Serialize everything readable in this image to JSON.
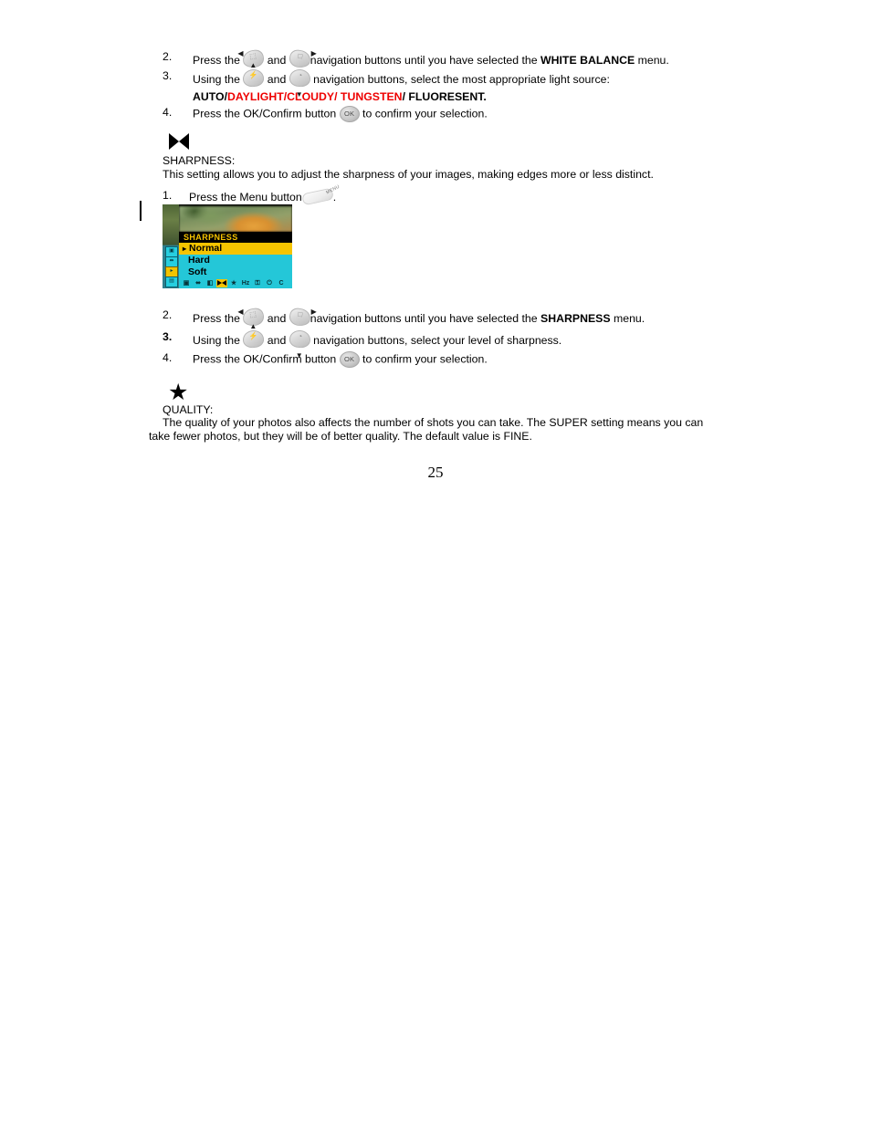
{
  "document": {
    "page_number": "25"
  },
  "white_balance_steps": {
    "step2": {
      "number": "2.",
      "text_before": "Press the",
      "text_mid": "and",
      "text_after": "navigation buttons until you have selected the",
      "emphasis": "WHITE BALANCE",
      "text_end": "menu."
    },
    "step3": {
      "number": "3.",
      "text_before": "Using the",
      "text_mid": "and",
      "text_after": "navigation buttons, select the most appropriate light source:",
      "options_plain_1": "AUTO/",
      "options_red": "DAYLIGHT/CLOUDY/ TUNGSTEN",
      "options_plain_2": "/ FLUORESENT."
    },
    "step4": {
      "number": "4.",
      "text_before": "Press the OK/Confirm button",
      "text_after": "to confirm your selection."
    }
  },
  "sharpness_section": {
    "icon": "bowtie-icon",
    "title": "SHARPNESS:",
    "description": "This setting allows you to adjust the sharpness of your images, making edges more or less distinct.",
    "step1": {
      "number": "1.",
      "text_before": "Press the Menu button",
      "text_after": "."
    },
    "step2": {
      "number": "2.",
      "text_before": "Press the",
      "text_mid": "and",
      "text_after": "navigation buttons until you have selected the",
      "emphasis": "SHARPNESS",
      "text_end": "menu."
    },
    "step3": {
      "number": "3.",
      "text_before": "Using the",
      "text_mid": "and",
      "text_after": "navigation buttons, select your level of sharpness."
    },
    "step4": {
      "number": "4.",
      "text_before": "Press the OK/Confirm button",
      "text_after": "to confirm your selection."
    }
  },
  "lcd_figure": {
    "menu_title": "SHARPNESS",
    "options": [
      {
        "label": "Normal",
        "selected": true,
        "caret": "▸"
      },
      {
        "label": "Hard",
        "selected": false,
        "caret": ""
      },
      {
        "label": "Soft",
        "selected": false,
        "caret": ""
      }
    ],
    "status_bar_icons": [
      {
        "name": "image-size-icon",
        "glyph": "▣",
        "highlighted": false
      },
      {
        "name": "exposure-icon",
        "glyph": "⬌",
        "highlighted": false
      },
      {
        "name": "white-balance-icon",
        "glyph": "◧",
        "highlighted": false
      },
      {
        "name": "sharpness-icon",
        "glyph": "",
        "highlighted": true
      },
      {
        "name": "quality-star-icon",
        "glyph": "★",
        "highlighted": false
      },
      {
        "name": "frequency-hz-icon",
        "glyph": "Hz",
        "highlighted": false
      },
      {
        "name": "lock-icon",
        "glyph": "⚿",
        "highlighted": false
      },
      {
        "name": "power-icon",
        "glyph": "⏻",
        "highlighted": false
      },
      {
        "name": "language-icon",
        "glyph": "C",
        "highlighted": false
      }
    ],
    "rail_icons": [
      {
        "name": "rail-icon-1",
        "glyph": "▣",
        "highlighted": false
      },
      {
        "name": "rail-icon-2",
        "glyph": "⬌",
        "highlighted": false
      },
      {
        "name": "rail-icon-3",
        "glyph": "▸",
        "highlighted": true
      },
      {
        "name": "rail-icon-4",
        "glyph": "▤",
        "highlighted": false
      }
    ]
  },
  "quality_section": {
    "icon": "star-icon",
    "title": "QUALITY:",
    "paragraph_line1": "The quality of your photos also affects the number of shots you can take. The SUPER setting means you can",
    "paragraph_line2": "take fewer photos, but they will be of better quality. The default value is FINE."
  },
  "button_glyphs": {
    "left_key": "⬚",
    "right_key": "□",
    "flash_key": "⚡",
    "timer_key": "◔",
    "ok_label": "OK",
    "menu_label": "MENU",
    "arrow_left": "◀",
    "arrow_right": "▶",
    "arrow_up": "▲",
    "arrow_down": "▼"
  },
  "colors": {
    "red_emphasis": "#ee0000",
    "lcd_cyan": "#24c7d8",
    "lcd_yellow": "#f5c400",
    "lcd_black": "#000000"
  }
}
